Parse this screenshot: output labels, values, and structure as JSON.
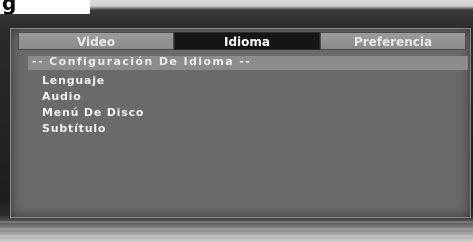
{
  "window": {
    "title_fragment": "g"
  },
  "tabs": [
    {
      "label": "Video",
      "selected": false
    },
    {
      "label": "Idioma",
      "selected": true
    },
    {
      "label": "Preferencia",
      "selected": false
    }
  ],
  "section": {
    "header": "-- Configuración De Idioma --"
  },
  "menu": {
    "items": [
      {
        "label": "Lenguaje"
      },
      {
        "label": "Audio"
      },
      {
        "label": "Menú De Disco"
      },
      {
        "label": "Subtítulo"
      }
    ]
  },
  "colors": {
    "panel": "#6a6a6a",
    "tab_selected": "#151515",
    "tab_normal": "#8a8a8a",
    "header_bar": "#8c8c8c",
    "text": "#f2f2f2"
  }
}
